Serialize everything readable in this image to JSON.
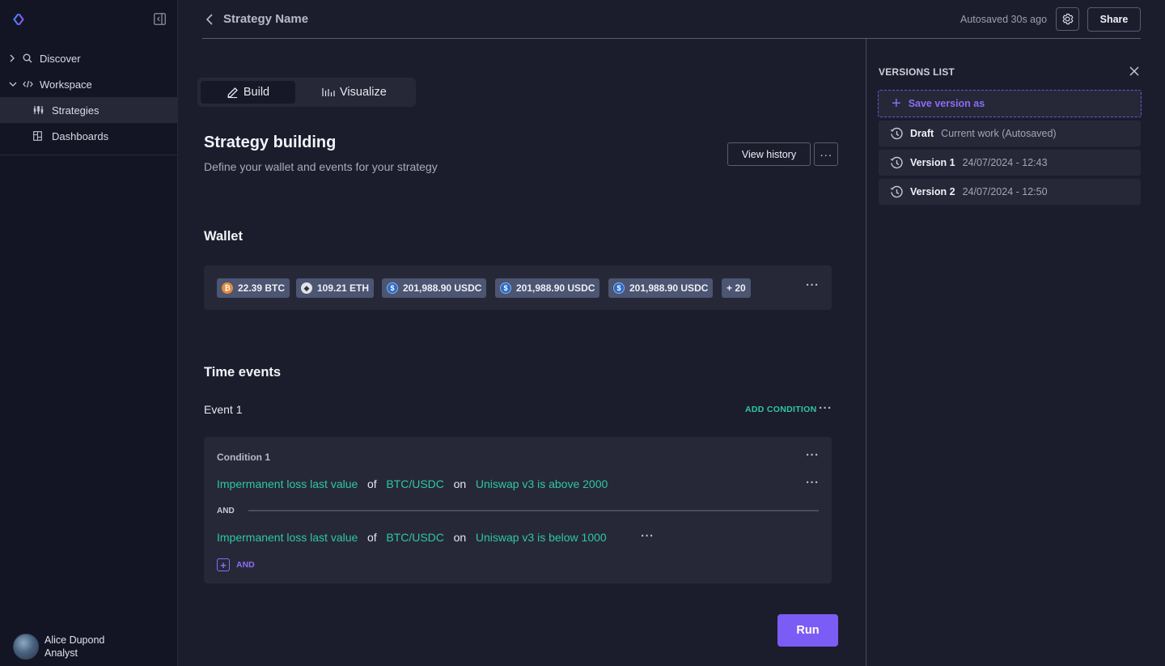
{
  "sidebar": {
    "items": [
      {
        "label": "Discover",
        "icon": "search-icon",
        "expanded": false
      },
      {
        "label": "Workspace",
        "icon": "code-icon",
        "expanded": true
      },
      {
        "label": "Strategies",
        "icon": "strategies-icon",
        "active": true
      },
      {
        "label": "Dashboards",
        "icon": "dashboard-icon"
      }
    ],
    "user": {
      "name": "Alice Dupond",
      "role": "Analyst"
    }
  },
  "header": {
    "title": "Strategy Name",
    "autosaved": "Autosaved 30s ago",
    "share_label": "Share"
  },
  "tabs": [
    {
      "label": "Build",
      "active": true
    },
    {
      "label": "Visualize",
      "active": false
    }
  ],
  "section": {
    "title": "Strategy building",
    "subtitle": "Define your wallet and events for your strategy",
    "view_history_label": "View history"
  },
  "wallet": {
    "title": "Wallet",
    "chips": [
      {
        "label": "22.39 BTC",
        "coin": "btc"
      },
      {
        "label": "109.21 ETH",
        "coin": "eth"
      },
      {
        "label": "201,988.90 USDC",
        "coin": "usdc"
      },
      {
        "label": "201,988.90 USDC",
        "coin": "usdc"
      },
      {
        "label": "201,988.90 USDC",
        "coin": "usdc"
      },
      {
        "label": "+ 20",
        "coin": ""
      }
    ]
  },
  "time_events": {
    "title": "Time events",
    "event_label": "Event 1",
    "add_condition_label": "ADD CONDITION",
    "condition": {
      "title": "Condition 1",
      "rules": [
        {
          "metric": "Impermanent loss last value",
          "of": "of",
          "pair": "BTC/USDC",
          "on": "on",
          "target": "Uniswap v3 is above 2000"
        },
        {
          "metric": "Impermanent loss last value",
          "of": "of",
          "pair": "BTC/USDC",
          "on": "on",
          "target": "Uniswap v3 is below 1000"
        }
      ],
      "and_label": "AND",
      "add_and_label": "AND"
    }
  },
  "run_label": "Run",
  "versions": {
    "title": "VERSIONS LIST",
    "save_as_label": "Save version as",
    "list": [
      {
        "name": "Draft",
        "meta": "Current work (Autosaved)"
      },
      {
        "name": "Version 1",
        "meta": "24/07/2024 - 12:43"
      },
      {
        "name": "Version 2",
        "meta": "24/07/2024 - 12:50"
      }
    ]
  },
  "colors": {
    "accent": "#7b5cf5",
    "green": "#2ec8a0",
    "background": "#1c1d2c",
    "sidebar": "#141524"
  }
}
